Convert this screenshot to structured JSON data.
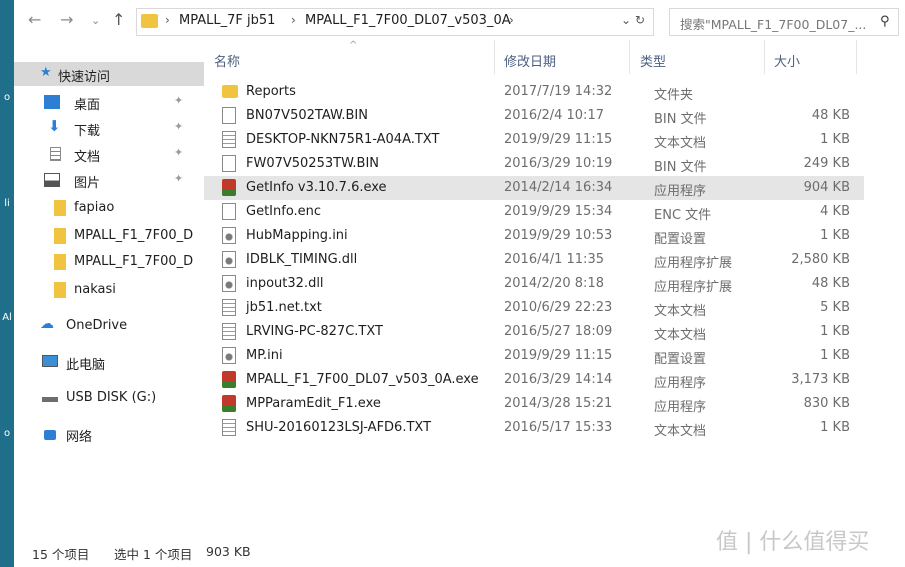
{
  "address_bar": {
    "back_icon": "arrow-left-icon",
    "forward_icon": "arrow-right-icon",
    "dropdown_icon": "chevron-down-icon",
    "up_icon": "arrow-up-icon",
    "breadcrumbs": [
      "MPALL_7F jb51",
      "MPALL_F1_7F00_DL07_v503_0A"
    ],
    "refresh_icon": "refresh-icon",
    "search_placeholder": "搜索\"MPALL_F1_7F00_DL07_... ",
    "search_icon": "search-icon"
  },
  "nav_pane": {
    "items": [
      {
        "label": "快速访问",
        "icon": "star-icon",
        "pinned": false
      },
      {
        "label": "桌面",
        "icon": "desktop-icon",
        "pinned": true
      },
      {
        "label": "下载",
        "icon": "download-icon",
        "pinned": true
      },
      {
        "label": "文档",
        "icon": "document-icon",
        "pinned": true
      },
      {
        "label": "图片",
        "icon": "picture-icon",
        "pinned": true
      },
      {
        "label": "fapiao",
        "icon": "folder-icon",
        "pinned": false
      },
      {
        "label": "MPALL_F1_7F00_D",
        "icon": "folder-icon",
        "pinned": false
      },
      {
        "label": "MPALL_F1_7F00_D",
        "icon": "folder-icon",
        "pinned": false
      },
      {
        "label": "nakasi",
        "icon": "folder-icon",
        "pinned": false
      },
      {
        "label": "OneDrive",
        "icon": "cloud-icon",
        "pinned": false
      },
      {
        "label": "此电脑",
        "icon": "computer-icon",
        "pinned": false
      },
      {
        "label": "USB DISK (G:)",
        "icon": "usb-drive-icon",
        "pinned": false
      },
      {
        "label": "网络",
        "icon": "network-icon",
        "pinned": false
      }
    ]
  },
  "columns": {
    "name": "名称",
    "date": "修改日期",
    "type": "类型",
    "size": "大小"
  },
  "files": [
    {
      "name": "Reports",
      "date": "2017/7/19 14:32",
      "type": "文件夹",
      "size": "",
      "icon": "folder"
    },
    {
      "name": "BN07V502TAW.BIN",
      "date": "2016/2/4 10:17",
      "type": "BIN 文件",
      "size": "48 KB",
      "icon": "file"
    },
    {
      "name": "DESKTOP-NKN75R1-A04A.TXT",
      "date": "2019/9/29 11:15",
      "type": "文本文档",
      "size": "1 KB",
      "icon": "text"
    },
    {
      "name": "FW07V50253TW.BIN",
      "date": "2016/3/29 10:19",
      "type": "BIN 文件",
      "size": "249 KB",
      "icon": "file"
    },
    {
      "name": "GetInfo v3.10.7.6.exe",
      "date": "2014/2/14 16:34",
      "type": "应用程序",
      "size": "904 KB",
      "icon": "exe"
    },
    {
      "name": "GetInfo.enc",
      "date": "2019/9/29 15:34",
      "type": "ENC 文件",
      "size": "4 KB",
      "icon": "file"
    },
    {
      "name": "HubMapping.ini",
      "date": "2019/9/29 10:53",
      "type": "配置设置",
      "size": "1 KB",
      "icon": "gear"
    },
    {
      "name": "IDBLK_TIMING.dll",
      "date": "2016/4/1 11:35",
      "type": "应用程序扩展",
      "size": "2,580 KB",
      "icon": "gear"
    },
    {
      "name": "inpout32.dll",
      "date": "2014/2/20 8:18",
      "type": "应用程序扩展",
      "size": "48 KB",
      "icon": "gear"
    },
    {
      "name": "jb51.net.txt",
      "date": "2010/6/29 22:23",
      "type": "文本文档",
      "size": "5 KB",
      "icon": "text"
    },
    {
      "name": "LRVING-PC-827C.TXT",
      "date": "2016/5/27 18:09",
      "type": "文本文档",
      "size": "1 KB",
      "icon": "text"
    },
    {
      "name": "MP.ini",
      "date": "2019/9/29 11:15",
      "type": "配置设置",
      "size": "1 KB",
      "icon": "gear"
    },
    {
      "name": "MPALL_F1_7F00_DL07_v503_0A.exe",
      "date": "2016/3/29 14:14",
      "type": "应用程序",
      "size": "3,173 KB",
      "icon": "exe"
    },
    {
      "name": "MPParamEdit_F1.exe",
      "date": "2014/3/28 15:21",
      "type": "应用程序",
      "size": "830 KB",
      "icon": "exe"
    },
    {
      "name": "SHU-20160123LSJ-AFD6.TXT",
      "date": "2016/5/17 15:33",
      "type": "文本文档",
      "size": "1 KB",
      "icon": "text"
    }
  ],
  "selected_index": 4,
  "status_bar": {
    "count": "15 个项目",
    "selected": "选中 1 个项目",
    "size": "903 KB"
  },
  "watermark": "值 | 什么值得买"
}
